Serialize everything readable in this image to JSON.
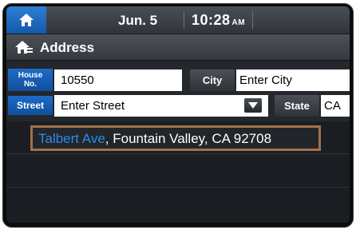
{
  "status_bar": {
    "date": "Jun. 5",
    "time": "10:28",
    "ampm": "AM",
    "home_icon": "home-icon"
  },
  "title_bar": {
    "icon": "address-book-home-icon",
    "title": "Address"
  },
  "form": {
    "house_no": {
      "label_line1": "House",
      "label_line2": "No.",
      "value": "10550"
    },
    "city": {
      "label": "City",
      "value": "Enter City"
    },
    "street": {
      "label": "Street",
      "value": "Enter Street",
      "dropdown_icon": "chevron-down-icon"
    },
    "state": {
      "label": "State",
      "value": "CA"
    }
  },
  "results": [
    {
      "match": "Talbert Ave",
      "rest": ", Fountain Valley, CA 92708"
    }
  ],
  "colors": {
    "accent_blue": "#1d6cc6",
    "match_text": "#2e8be8",
    "highlight_border": "#a0724a"
  }
}
